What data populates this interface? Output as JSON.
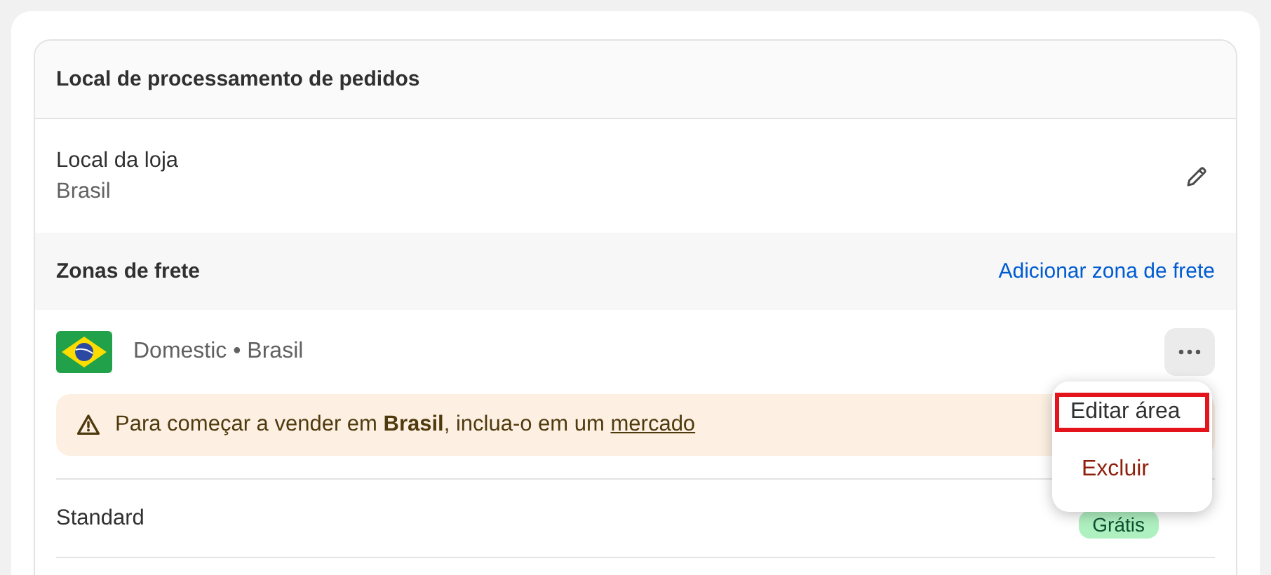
{
  "section_title": "Local de processamento de pedidos",
  "store": {
    "label": "Local da loja",
    "value": "Brasil"
  },
  "zones": {
    "title": "Zonas de frete",
    "add_link": "Adicionar zona de frete"
  },
  "zone": {
    "name": "Domestic • Brasil",
    "warning": "Para começar a vender em **Brasil**, inclua-o em um",
    "warning_link": "mercado"
  },
  "rates": [
    {
      "name": "Standard",
      "badge": "Grátis"
    }
  ],
  "menu": [
    {
      "label": "Editar área",
      "kind": "normal",
      "highlighted": true
    },
    {
      "label": "Excluir",
      "kind": "danger",
      "highlighted": false
    }
  ]
}
